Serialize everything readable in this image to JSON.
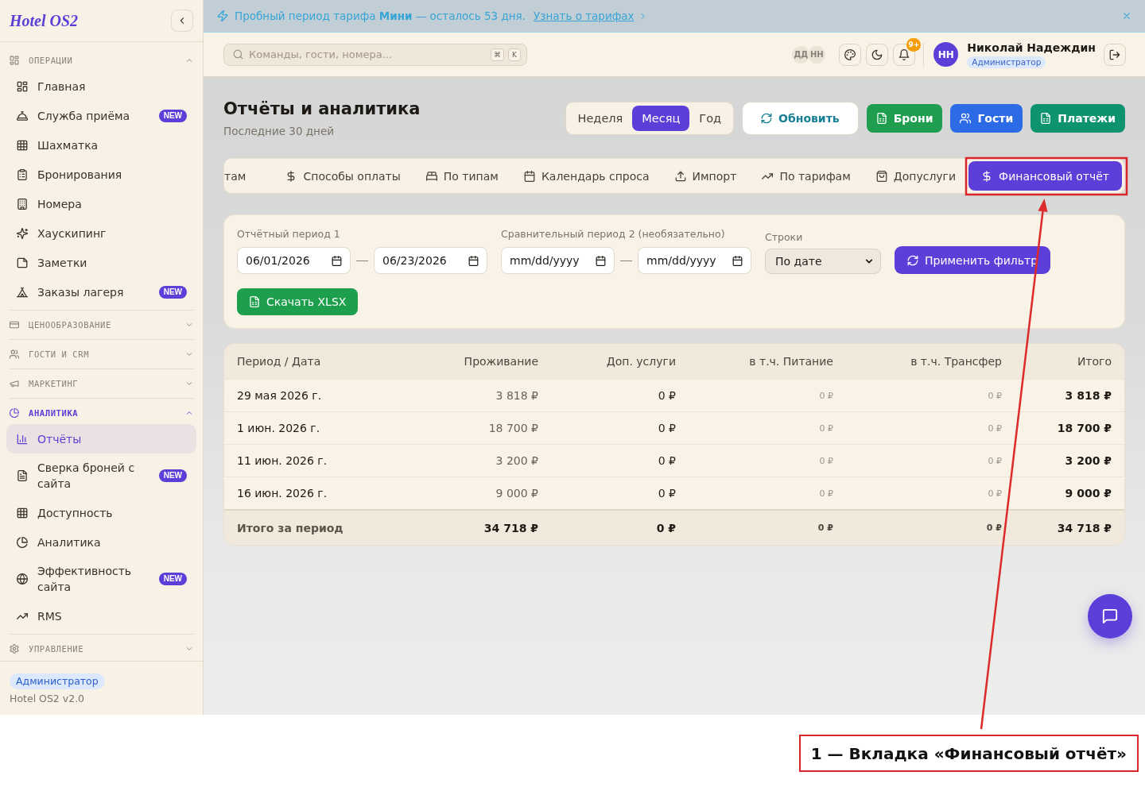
{
  "sidebar": {
    "logo": "Hotel OS2",
    "sections": [
      {
        "title": "ОПЕРАЦИИ",
        "expanded": true,
        "items": [
          {
            "label": "Главная",
            "selected": false
          },
          {
            "label": "Служба приёма",
            "badge": "NEW",
            "selected": false
          },
          {
            "label": "Шахматка",
            "selected": false
          },
          {
            "label": "Бронирования",
            "selected": false
          },
          {
            "label": "Номера",
            "selected": false
          },
          {
            "label": "Хаускипинг",
            "selected": false
          },
          {
            "label": "Заметки",
            "selected": false
          },
          {
            "label": "Заказы лагеря",
            "badge": "NEW",
            "selected": false
          }
        ]
      },
      {
        "title": "ЦЕНООБРАЗОВАНИЕ",
        "expanded": false
      },
      {
        "title": "ГОСТИ И CRM",
        "expanded": false
      },
      {
        "title": "МАРКЕТИНГ",
        "expanded": false
      },
      {
        "title": "АНАЛИТИКА",
        "expanded": true,
        "items": [
          {
            "label": "Отчёты",
            "selected": true
          },
          {
            "label": "Сверка броней с сайта",
            "badge": "NEW",
            "selected": false
          },
          {
            "label": "Доступность",
            "selected": false
          },
          {
            "label": "Аналитика",
            "selected": false
          },
          {
            "label": "Эффективность сайта",
            "badge": "NEW",
            "selected": false
          },
          {
            "label": "RMS",
            "selected": false
          }
        ]
      },
      {
        "title": "УПРАВЛЕНИЕ",
        "expanded": false
      }
    ],
    "footer": {
      "role": "Администратор",
      "version": "Hotel OS2 v2.0"
    }
  },
  "trial_banner": {
    "text": "Пробный период тарифа **Мини** — осталось 53 дня.",
    "link": "Узнать о тарифах"
  },
  "top_bar": {
    "search": {
      "placeholder": "Команды, гости, номера...",
      "shortcut": [
        "⌘",
        "K"
      ]
    },
    "online_users": [
      "ДД",
      "НН"
    ],
    "notifications_badge": "9+",
    "user": {
      "initials": "НН",
      "name": "Николай Надеждин",
      "role": "Администратор"
    }
  },
  "page": {
    "title": "Отчёты и аналитика",
    "subtitle": "Последние 30 дней"
  },
  "periods": [
    {
      "label": "Неделя",
      "selected": false
    },
    {
      "label": "Месяц",
      "selected": true
    },
    {
      "label": "Год",
      "selected": false
    }
  ],
  "refresh_button": "Обновить",
  "action_buttons": [
    {
      "label": "Брони",
      "color": "#1e9e4e"
    },
    {
      "label": "Гости",
      "color": "#2c6ae6"
    },
    {
      "label": "Платежи",
      "color": "#0e936f"
    }
  ],
  "report_tabs": [
    {
      "label": "там",
      "selected": false
    },
    {
      "label": "Способы оплаты",
      "selected": false
    },
    {
      "label": "По типам",
      "selected": false
    },
    {
      "label": "Календарь спроса",
      "selected": false
    },
    {
      "label": "Импорт",
      "selected": false
    },
    {
      "label": "По тарифам",
      "selected": false
    },
    {
      "label": "Допуслуги",
      "selected": false
    },
    {
      "label": "Финансовый отчёт",
      "selected": true
    }
  ],
  "filters": {
    "date_ranges": [
      {
        "label": "Отчётный период 1",
        "from": {
          "value": "06/01/2026"
        },
        "to": {
          "value": "06/23/2026"
        }
      },
      {
        "label": "Сравнительный период 2 (необязательно)",
        "from": {
          "placeholder": "mm/dd/yyyy"
        },
        "to": {
          "placeholder": "mm/dd/yyyy"
        }
      }
    ],
    "rows": {
      "label": "Строки",
      "value": "По дате"
    },
    "apply_button": "Применить фильтр",
    "download_button": "Скачать XLSX"
  },
  "table": {
    "columns": [
      "Период / Дата",
      "Проживание",
      "Доп. услуги",
      "в т.ч. Питание",
      "в т.ч. Трансфер",
      "Итого"
    ],
    "rows": [
      {
        "cells": [
          "29 мая 2026 г.",
          "3 818 ₽",
          "0 ₽",
          "0 ₽",
          "0 ₽",
          "3 818 ₽"
        ]
      },
      {
        "cells": [
          "1 июн. 2026 г.",
          "18 700 ₽",
          "0 ₽",
          "0 ₽",
          "0 ₽",
          "18 700 ₽"
        ]
      },
      {
        "cells": [
          "11 июн. 2026 г.",
          "3 200 ₽",
          "0 ₽",
          "0 ₽",
          "0 ₽",
          "3 200 ₽"
        ]
      },
      {
        "cells": [
          "16 июн. 2026 г.",
          "9 000 ₽",
          "0 ₽",
          "0 ₽",
          "0 ₽",
          "9 000 ₽"
        ]
      }
    ],
    "total": {
      "cells": [
        "Итого за период",
        "34 718 ₽",
        "0 ₽",
        "0 ₽",
        "0 ₽",
        "34 718 ₽"
      ]
    }
  },
  "annotation": {
    "label": "1 — Вкладка «Финансовый отчёт»"
  }
}
